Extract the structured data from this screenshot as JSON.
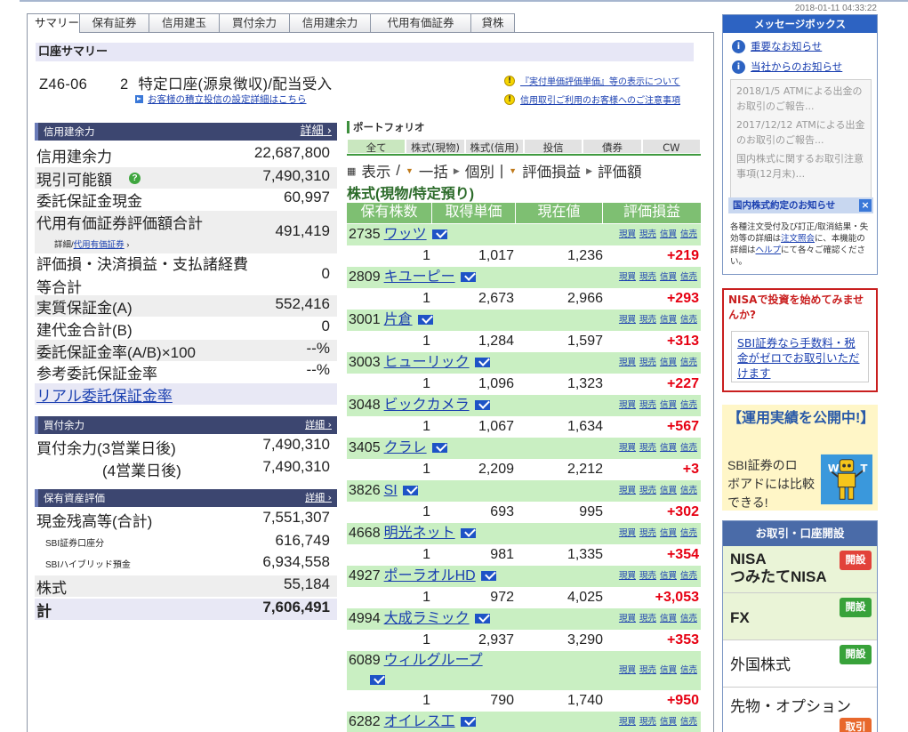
{
  "timestamp": "2018-01-11 04:33:22",
  "tabs": [
    "サマリー",
    "保有証券",
    "信用建玉",
    "買付余力",
    "信用建余力",
    "代用有価証券",
    "貸株"
  ],
  "summary": {
    "header": "口座サマリー",
    "account_no": "Z46-06",
    "account_num": "2",
    "account_type": "特定口座(源泉徴収)/配当受入",
    "sub_link": "お客様の積立投信の設定詳細はこちら",
    "notice1": "『実付単価評価単価』等の表示について",
    "notice2": "信用取引ご利用のお客様へのご注意事項"
  },
  "credit": {
    "header": "信用建余力",
    "detail": "詳細",
    "rows": [
      {
        "k": "信用建余力",
        "v": "22,687,800"
      },
      {
        "k": "現引可能額",
        "v": "7,490,310"
      },
      {
        "k": "委託保証金現金",
        "v": "60,997"
      },
      {
        "k": "代用有価証券評価額合計",
        "v": "491,419"
      },
      {
        "k": "評価損・決済損益・支払諸経費",
        "v": "0"
      },
      {
        "k": "実質保証金(A)",
        "v": "552,416"
      },
      {
        "k": "建代金合計(B)",
        "v": "0"
      },
      {
        "k": "委託保証金率(A/B)×100",
        "v": "--%"
      },
      {
        "k": "参考委託保証金率",
        "v": "--%"
      }
    ],
    "row5_line2": "等合計",
    "sub_detail": "詳細/",
    "sub_detail_link": "代用有価証券",
    "real_link": "リアル委託保証金率"
  },
  "kaitsuke": {
    "header": "買付余力",
    "detail": "詳細",
    "r1k": "買付余力(3営業日後)",
    "r1v": "7,490,310",
    "r2k": "(4営業日後)",
    "r2v": "7,490,310"
  },
  "assets": {
    "header": "保有資産評価",
    "detail": "詳細",
    "rows": [
      {
        "k": "現金残高等(合計)",
        "v": "7,551,307"
      },
      {
        "k": "SBI証券口座分",
        "v": "616,749"
      },
      {
        "k": "SBIハイブリッド預金",
        "v": "6,934,558"
      },
      {
        "k": "株式",
        "v": "55,184"
      },
      {
        "k": "計",
        "v": "7,606,491"
      }
    ]
  },
  "portfolio": {
    "title": "ポートフォリオ",
    "tabs": [
      "全て",
      "株式(現物)",
      "株式(信用)",
      "投信",
      "債券",
      "CW"
    ],
    "controls": [
      "表示",
      "/",
      "一括",
      "個別",
      "|",
      "評価損益",
      "評価額"
    ],
    "section": "株式(現物/特定預り)",
    "cols": [
      "保有株数",
      "取得単価",
      "現在値",
      "評価損益"
    ],
    "actions": [
      "現買",
      "現売",
      "信買",
      "信売"
    ],
    "stocks": [
      {
        "code": "2735",
        "name": "ワッツ",
        "qty": "1",
        "buy": "1,017",
        "cur": "1,236",
        "pl": "+219"
      },
      {
        "code": "2809",
        "name": "キユーピー",
        "qty": "1",
        "buy": "2,673",
        "cur": "2,966",
        "pl": "+293"
      },
      {
        "code": "3001",
        "name": "片倉",
        "qty": "1",
        "buy": "1,284",
        "cur": "1,597",
        "pl": "+313"
      },
      {
        "code": "3003",
        "name": "ヒューリック",
        "qty": "1",
        "buy": "1,096",
        "cur": "1,323",
        "pl": "+227"
      },
      {
        "code": "3048",
        "name": "ビックカメラ",
        "qty": "1",
        "buy": "1,067",
        "cur": "1,634",
        "pl": "+567"
      },
      {
        "code": "3405",
        "name": "クラレ",
        "qty": "1",
        "buy": "2,209",
        "cur": "2,212",
        "pl": "+3"
      },
      {
        "code": "3826",
        "name": "SI",
        "qty": "1",
        "buy": "693",
        "cur": "995",
        "pl": "+302"
      },
      {
        "code": "4668",
        "name": "明光ネット",
        "qty": "1",
        "buy": "981",
        "cur": "1,335",
        "pl": "+354"
      },
      {
        "code": "4927",
        "name": "ポーラオルHD",
        "qty": "1",
        "buy": "972",
        "cur": "4,025",
        "pl": "+3,053"
      },
      {
        "code": "4994",
        "name": "大成ラミック",
        "qty": "1",
        "buy": "2,937",
        "cur": "3,290",
        "pl": "+353"
      },
      {
        "code": "6089",
        "name": "ウィルグループ",
        "qty": "1",
        "buy": "790",
        "cur": "1,740",
        "pl": "+950"
      },
      {
        "code": "6282",
        "name": "オイレス工",
        "qty": "",
        "buy": "",
        "cur": "",
        "pl": ""
      }
    ]
  },
  "msgbox": {
    "header": "メッセージボックス",
    "link1": "重要なお知らせ",
    "link2": "当社からのお知らせ",
    "items": [
      "2018/1/5 ATMによる出金のお取引のご報告...",
      "2017/12/12 ATMによる出金のお取引のご報告...",
      "国内株式に関するお取引注意事項(12月末)..."
    ],
    "yaku_header": "国内株式約定のお知らせ",
    "yaku_text": "各種注文受付及び訂正/取消結果・失効等の詳細は",
    "yaku_link1": "注文照会",
    "yaku_mid": "に、本機能の詳細は",
    "yaku_link2": "ヘルプ",
    "yaku_end": "にて各々ご確認ください。"
  },
  "nisa": {
    "title": "NISAで投資を始めてみませんか?",
    "body": "SBI証券なら手数料・税金がゼロでお取引いただけます"
  },
  "unyo": {
    "title": "【運用実績を公開中!】",
    "body1": "SBI証券のロ",
    "body2": "ボアドには比較",
    "body3": "できる!",
    "robot_w": "W",
    "robot_t": "T"
  },
  "torihiki": {
    "header": "お取引・口座開設",
    "items": [
      {
        "l1": "NISA",
        "l2": "つみたてNISA",
        "btn": "開設",
        "color": "red"
      },
      {
        "l1": "FX",
        "l2": "",
        "btn": "開設",
        "color": "green"
      },
      {
        "l1": "外国株式",
        "l2": "",
        "btn": "開設",
        "color": "green"
      },
      {
        "l1": "先物・オプション",
        "l2": "",
        "btn": "取引",
        "color": "orange"
      }
    ]
  }
}
